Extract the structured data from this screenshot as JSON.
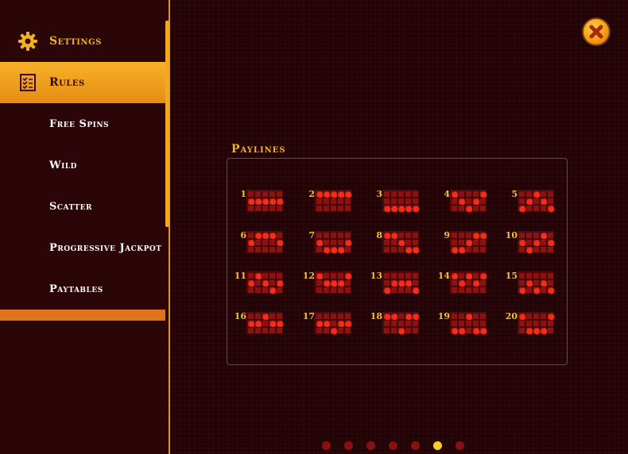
{
  "menu": {
    "items": [
      {
        "label": "Settings",
        "kind": "primary",
        "icon": "gear-icon",
        "active": false
      },
      {
        "label": "Rules",
        "kind": "primary",
        "icon": "checklist-icon",
        "active": true
      },
      {
        "label": "Free Spins",
        "kind": "sub",
        "active": false
      },
      {
        "label": "Wild",
        "kind": "sub",
        "active": false
      },
      {
        "label": "Scatter",
        "kind": "sub",
        "active": false
      },
      {
        "label": "Progressive Jackpot",
        "kind": "sub",
        "active": false
      },
      {
        "label": "Paytables",
        "kind": "sub",
        "active": false
      }
    ]
  },
  "close_icon": "close-icon",
  "paylines": {
    "title": "Paylines",
    "lines": [
      {
        "number": "1",
        "rows": [
          1,
          1,
          1,
          1,
          1
        ]
      },
      {
        "number": "2",
        "rows": [
          0,
          0,
          0,
          0,
          0
        ]
      },
      {
        "number": "3",
        "rows": [
          2,
          2,
          2,
          2,
          2
        ]
      },
      {
        "number": "4",
        "rows": [
          0,
          1,
          2,
          1,
          0
        ]
      },
      {
        "number": "5",
        "rows": [
          2,
          1,
          0,
          1,
          2
        ]
      },
      {
        "number": "6",
        "rows": [
          1,
          0,
          0,
          0,
          1
        ]
      },
      {
        "number": "7",
        "rows": [
          1,
          2,
          2,
          2,
          1
        ]
      },
      {
        "number": "8",
        "rows": [
          0,
          0,
          1,
          2,
          2
        ]
      },
      {
        "number": "9",
        "rows": [
          2,
          2,
          1,
          0,
          0
        ]
      },
      {
        "number": "10",
        "rows": [
          1,
          2,
          1,
          0,
          1
        ]
      },
      {
        "number": "11",
        "rows": [
          1,
          0,
          1,
          2,
          1
        ]
      },
      {
        "number": "12",
        "rows": [
          0,
          1,
          1,
          1,
          0
        ]
      },
      {
        "number": "13",
        "rows": [
          2,
          1,
          1,
          1,
          2
        ]
      },
      {
        "number": "14",
        "rows": [
          0,
          1,
          0,
          1,
          0
        ]
      },
      {
        "number": "15",
        "rows": [
          2,
          1,
          2,
          1,
          2
        ]
      },
      {
        "number": "16",
        "rows": [
          1,
          1,
          0,
          1,
          1
        ]
      },
      {
        "number": "17",
        "rows": [
          1,
          1,
          2,
          1,
          1
        ]
      },
      {
        "number": "18",
        "rows": [
          0,
          0,
          2,
          0,
          0
        ]
      },
      {
        "number": "19",
        "rows": [
          2,
          2,
          0,
          2,
          2
        ]
      },
      {
        "number": "20",
        "rows": [
          0,
          2,
          2,
          2,
          0
        ]
      }
    ]
  },
  "pagination": {
    "count": 7,
    "active_index": 5
  },
  "colors": {
    "accent": "#f5b01e",
    "active_menu": "#f0a020",
    "payline_dot": "#ff2a14",
    "payline_bg": "#8a1210",
    "dot_active": "#f5d020",
    "dot_inactive": "#8a1010"
  }
}
